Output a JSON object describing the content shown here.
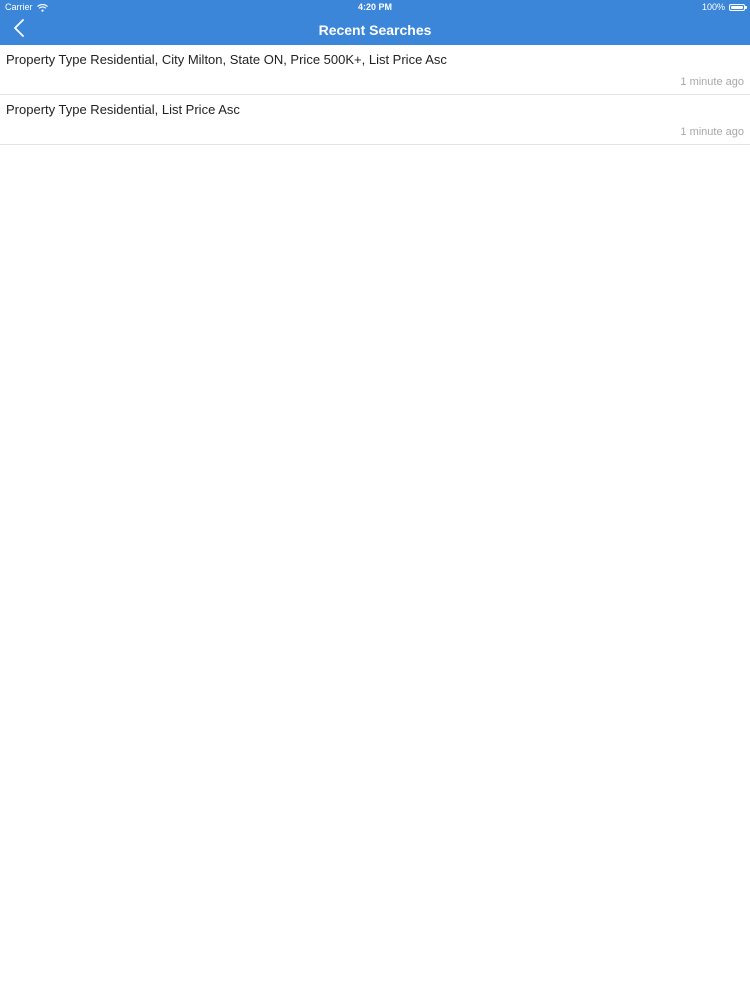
{
  "status_bar": {
    "carrier": "Carrier",
    "time": "4:20 PM",
    "battery": "100%",
    "wifi_icon": "wifi-icon",
    "battery_icon": "battery-icon"
  },
  "nav": {
    "title": "Recent Searches",
    "back_icon": "chevron-left-icon"
  },
  "colors": {
    "header_bg": "#3b86d8",
    "text": "#222222",
    "muted": "#a8a8a8",
    "divider": "#e3e3e3"
  },
  "recent_searches": [
    {
      "title": "Property Type Residential, City Milton, State ON, Price 500K+, List Price Asc",
      "time": "1 minute ago"
    },
    {
      "title": "Property Type Residential, List Price Asc",
      "time": "1 minute ago"
    }
  ]
}
